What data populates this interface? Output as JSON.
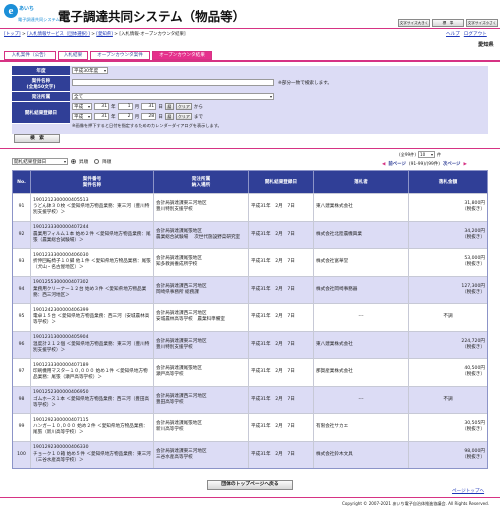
{
  "logo": {
    "line1": "あいち",
    "line2": "電子調達共同システム"
  },
  "title": "電子調達共同システム（物品等）",
  "header_buttons": [
    "文字サイズ大きく",
    "標　準",
    "文字サイズ小さく"
  ],
  "top_links": [
    "ヘルプ",
    "ログアウト"
  ],
  "breadcrumb": {
    "l1": "[トップ]",
    "sep1": " > ",
    "l2": "[入札情報サービス（団体選択）]",
    "sep2": " > ",
    "l3": "[愛知県]",
    "sep3": " > ",
    "cur": "[入札情報-オープンカウンタ結果]"
  },
  "org": "愛知県",
  "tabs": [
    "入札案件（公告）",
    "入札結果",
    "オープンカウンタ案件",
    "オープンカウンタ結果"
  ],
  "form": {
    "nendo_label": "年度",
    "nendo": "平成30年度",
    "name_label": "案件名称",
    "name_sub": "(全角50文字)",
    "name_hint": "※部分一致で検索します。",
    "dept_label": "発注所属",
    "dept": "全て",
    "date_label": "開札結果登録日",
    "from": {
      "era": "平成",
      "y": "31",
      "yu": "年",
      "m": "1",
      "mu": "月",
      "d": "31",
      "du": "日",
      "cal": "暦",
      "clear": "クリア",
      "suffix": "から"
    },
    "to": {
      "era": "平成",
      "y": "31",
      "yu": "年",
      "m": "2",
      "mu": "月",
      "d": "28",
      "du": "日",
      "cal": "暦",
      "clear": "クリア",
      "suffix": "まで"
    },
    "note": "※画像を押下すると日付を指定するためのカレンダーダイアログを表示します。",
    "search": "検　索"
  },
  "sort": {
    "field": "開札結果登録日",
    "asc": "昇順",
    "desc": "降順"
  },
  "paging": {
    "count": "(全99件)",
    "per": "10",
    "per_unit": "件",
    "prev": "前ページ",
    "range": "(91-99)/(99件)",
    "next": "次ページ"
  },
  "columns": {
    "no": "No.",
    "case_no": "案件番号",
    "case_name": "案件名称",
    "dept": "発注所属",
    "dept2": "納入場所",
    "date": "開札結果登録日",
    "winner": "落札者",
    "amount": "落札金額"
  },
  "rows": [
    {
      "no": "91",
      "num": "1901212300000405513",
      "name": "うどん鉢３０枚 ＜愛知県地方物品業務：東三河（豊川特別支援学校）＞",
      "dept1": "会計局調達課東三河地区",
      "dept2": "豊川特別支援学校",
      "date": "平成31年　2月　7日",
      "winner": "東八建業株式会社",
      "amount": "31,800円",
      "tax": "（税抜き）"
    },
    {
      "no": "92",
      "num": "1901233300000407244",
      "name": "農業用フィルム１本 始め２件 ＜愛知県地方物品業務：尾張（農業総合試験場）＞",
      "dept1": "会計局調達課尾張地区",
      "dept2": "農業総合試験場 　次世代施設野菜研究室",
      "date": "平成31年　2月　7日",
      "winner": "株式会社北陸農機興業",
      "amount": "34,200円",
      "tax": "（税抜き）"
    },
    {
      "no": "93",
      "num": "1901233300000406030",
      "name": "折伸回転椅子１０脚 他１件 ＜愛知県地方物品業務：尾張（犬山・名古屋地区）＞",
      "dept1": "会計局調達課尾張地区",
      "dept2": "知多教員養成所学校",
      "date": "平成31年　2月　7日",
      "winner": "株式会社富華堂",
      "amount": "53,000円",
      "tax": "（税抜き）"
    },
    {
      "no": "94",
      "num": "1901255300000407302",
      "name": "業務用クリーナー１２台 始め３件 ＜愛知県地方物品業務：西三河地区＞",
      "dept1": "会計局調達課西三河地区",
      "dept2": "岡崎県事務所 総務課",
      "date": "平成31年　2月　7日",
      "winner": "株式会社岡崎事務器",
      "amount": "127,300円",
      "tax": "（税抜き）"
    },
    {
      "no": "95",
      "num": "1901242300000406399",
      "name": "電卓１５台 ＜愛知県地方物品業務：西三河（安城農林高等学校）＞",
      "dept1": "会計局調達課西三河地区",
      "dept2": "安城農林高等学校　農業科準備室",
      "date": "平成31年　2月　7日",
      "winner": "---",
      "amount": "不調",
      "tax": ""
    },
    {
      "no": "96",
      "num": "1901231300000405904",
      "name": "温度計２１２個 ＜愛知県地方物品業務：東三河（豊川特別支援学校）＞",
      "dept1": "会計局調達課東三河地区",
      "dept2": "豊川特別支援学校",
      "date": "平成31年　2月　7日",
      "winner": "東八建業株式会社",
      "amount": "224,720円",
      "tax": "（税抜き）"
    },
    {
      "no": "97",
      "num": "1901233300000407189",
      "name": "印刷機用マスター１０,０００ 始め１件 ＜愛知県地方物品業務：尾張（瀬戸高等学校）＞",
      "dept1": "会計局調達課尾張地区",
      "dept2": "瀬戸高等学校",
      "date": "平成31年　2月　7日",
      "winner": "那賀産業株式会社",
      "amount": "40,500円",
      "tax": "（税抜き）"
    },
    {
      "no": "98",
      "num": "1901252300000406950",
      "name": "ゴムホース１本 ＜愛知県地方物品業務：西三河（豊田高等学校）＞",
      "dept1": "会計局調達課西三河地区",
      "dept2": "豊田高等学校",
      "date": "平成31年　2月　7日",
      "winner": "---",
      "amount": "不調",
      "tax": ""
    },
    {
      "no": "99",
      "num": "1901292300000407115",
      "name": "ハンガー１０,０００ 始め２件 ＜愛知県地方物品業務：尾張（新川高等学校）＞",
      "dept1": "会計局調達課尾張地区",
      "dept2": "新川高等学校",
      "date": "平成31年　2月　7日",
      "winner": "有限会社サカエ",
      "amount": "30,505円",
      "tax": "（税抜き）"
    },
    {
      "no": "100",
      "num": "1901292300000406330",
      "name": "チョーク１０箱 始め５件 ＜愛知県地方物品業務：東三河（三谷水産高等学校）＞",
      "dept1": "会計局調達課東三河地区",
      "dept2": "三谷水産高等学校",
      "date": "平成31年　2月　7日",
      "winner": "株式会社鈴木文具",
      "amount": "98,000円",
      "tax": "（税抜き）"
    }
  ],
  "back_button": "団体のトップページへ戻る",
  "page_top": "ページトップへ",
  "footer": "Copyright © 2007-2021 あいち電子自治体推進協議会. All Rights Reserved.",
  "colors": {
    "navy": "#303f97",
    "accent": "#d63384",
    "pink": "#e5318c"
  }
}
